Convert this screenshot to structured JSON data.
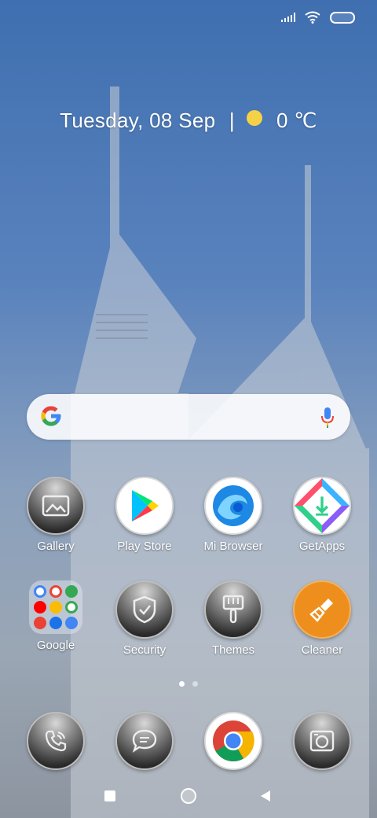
{
  "status_bar": {
    "signal_icon": "signal-icon",
    "wifi_icon": "wifi-icon",
    "battery_icon": "battery-icon"
  },
  "widget": {
    "date": "Tuesday, 08 Sep",
    "separator": "|",
    "weather_icon": "sun-icon",
    "temperature": "0 ℃"
  },
  "search": {
    "logo": "google-g-icon",
    "mic": "mic-icon"
  },
  "apps_row1": [
    {
      "label": "Gallery",
      "icon": "gallery-icon"
    },
    {
      "label": "Play Store",
      "icon": "play-store-icon"
    },
    {
      "label": "Mi Browser",
      "icon": "mi-browser-icon"
    },
    {
      "label": "GetApps",
      "icon": "getapps-icon"
    }
  ],
  "apps_row2": [
    {
      "label": "Google",
      "icon": "google-folder-icon"
    },
    {
      "label": "Security",
      "icon": "shield-icon"
    },
    {
      "label": "Themes",
      "icon": "brush-icon"
    },
    {
      "label": "Cleaner",
      "icon": "broom-icon"
    }
  ],
  "page_indicator": {
    "pages": 2,
    "current": 1
  },
  "dock": [
    {
      "icon": "phone-icon"
    },
    {
      "icon": "messages-icon"
    },
    {
      "icon": "chrome-icon"
    },
    {
      "icon": "camera-icon"
    }
  ],
  "nav": {
    "recents": "recents-icon",
    "home": "home-icon",
    "back": "back-icon"
  },
  "colors": {
    "sun": "#f5d245",
    "cleaner": "#ee8f1d",
    "wallpaper_top": "#3f6fb0"
  }
}
